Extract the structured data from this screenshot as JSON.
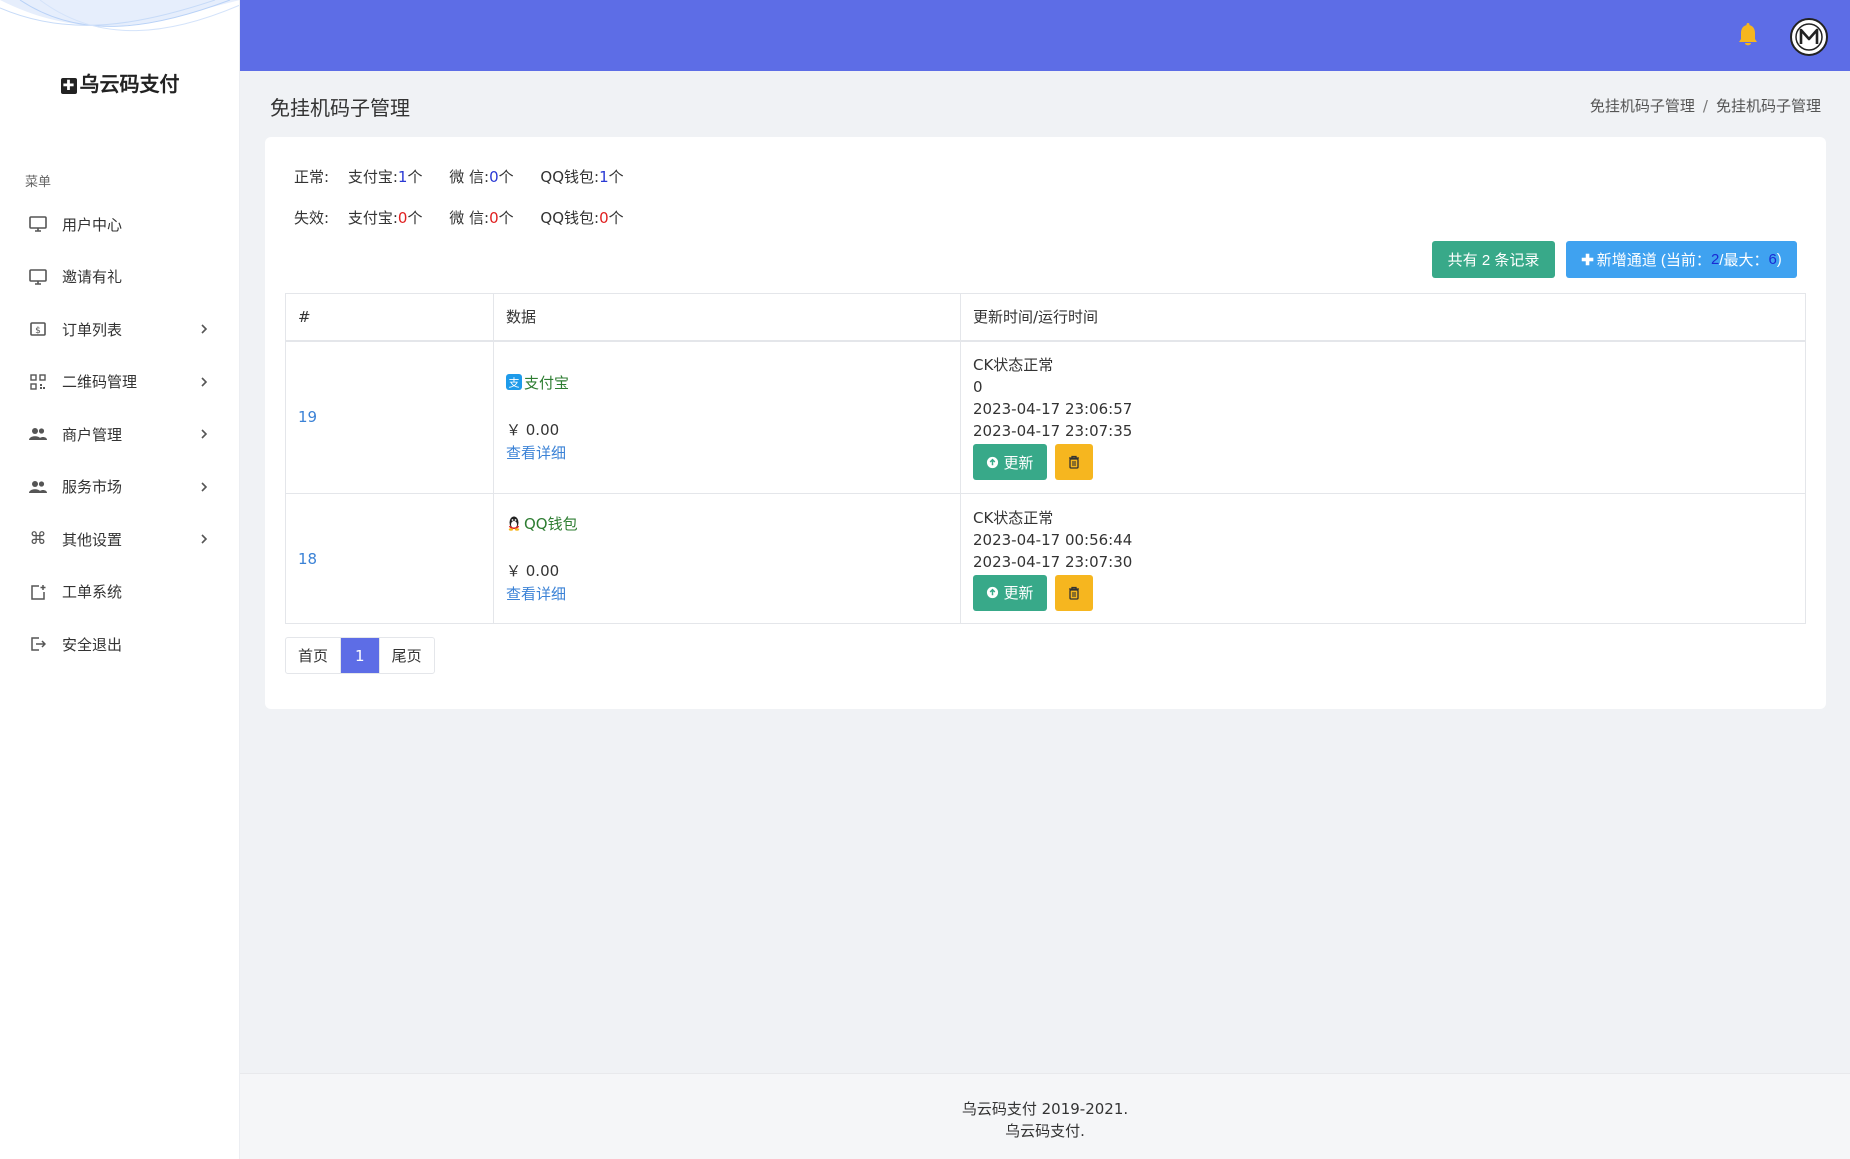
{
  "sidebar": {
    "brand": "乌云码支付",
    "menu_heading": "菜单",
    "items": [
      {
        "label": "用户中心",
        "icon": "monitor-icon",
        "has_children": false
      },
      {
        "label": "邀请有礼",
        "icon": "monitor-icon",
        "has_children": false
      },
      {
        "label": "订单列表",
        "icon": "dollar-box-icon",
        "has_children": true
      },
      {
        "label": "二维码管理",
        "icon": "qrcode-icon",
        "has_children": true
      },
      {
        "label": "商户管理",
        "icon": "users-icon",
        "has_children": true
      },
      {
        "label": "服务市场",
        "icon": "users-icon",
        "has_children": true
      },
      {
        "label": "其他设置",
        "icon": "command-icon",
        "has_children": true
      },
      {
        "label": "工单系统",
        "icon": "add-box-icon",
        "has_children": false
      },
      {
        "label": "安全退出",
        "icon": "logout-icon",
        "has_children": false
      }
    ]
  },
  "header": {
    "bell_color": "#f6b61f",
    "bar_color": "#5d6de6"
  },
  "page": {
    "title": "免挂机码子管理",
    "breadcrumb": [
      "免挂机码子管理",
      "免挂机码子管理"
    ]
  },
  "stats": {
    "normal_label": "正常:",
    "failed_label": "失效:",
    "normal": [
      {
        "name": "支付宝:",
        "count": "1",
        "unit": "个"
      },
      {
        "name": "微 信:",
        "count": "0",
        "unit": "个"
      },
      {
        "name": "QQ钱包:",
        "count": "1",
        "unit": "个"
      }
    ],
    "failed": [
      {
        "name": "支付宝:",
        "count": "0",
        "unit": "个"
      },
      {
        "name": "微 信:",
        "count": "0",
        "unit": "个"
      },
      {
        "name": "QQ钱包:",
        "count": "0",
        "unit": "个"
      }
    ]
  },
  "buttons": {
    "total_label": "共有 2 条记录",
    "add_prefix": "新增通道 (当前：",
    "add_current": "2",
    "add_mid": "/最大：",
    "add_max": "6",
    "add_suffix": ")"
  },
  "table": {
    "headers": [
      "#",
      "数据",
      "更新时间/运行时间"
    ],
    "rows": [
      {
        "id": "19",
        "channel": "支付宝",
        "amount": "￥ 0.00",
        "detail": "查看详细",
        "status": "CK状态正常",
        "extra": "0",
        "time1": "2023-04-17 23:06:57",
        "time2": "2023-04-17 23:07:35",
        "update_label": "更新"
      },
      {
        "id": "18",
        "channel": "QQ钱包",
        "amount": "￥ 0.00",
        "detail": "查看详细",
        "status": "CK状态正常",
        "time1": "2023-04-17 00:56:44",
        "time2": "2023-04-17 23:07:30",
        "update_label": "更新"
      }
    ]
  },
  "pager": {
    "first": "首页",
    "current": "1",
    "last": "尾页"
  },
  "footer": {
    "line1": "乌云码支付 2019-2021.",
    "line2": "乌云码支付."
  }
}
